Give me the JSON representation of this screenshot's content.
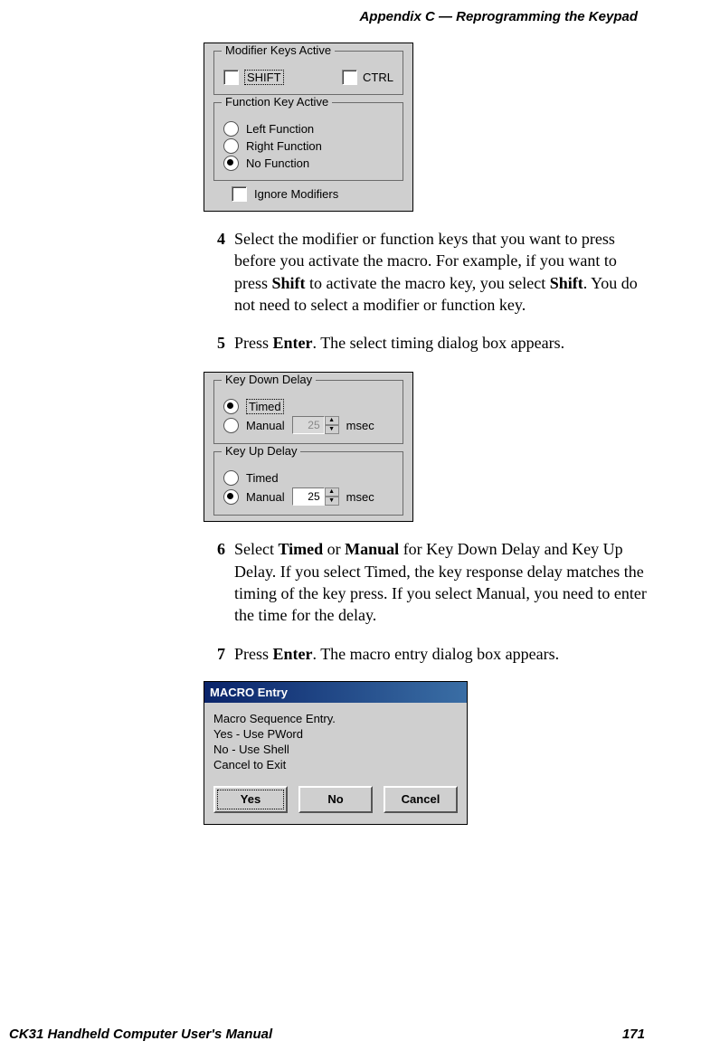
{
  "header": "Appendix C — Reprogramming the Keypad",
  "footer_left": "CK31 Handheld Computer User's Manual",
  "footer_right": "171",
  "panel1": {
    "group1_title": "Modifier Keys Active",
    "shift": "SHIFT",
    "ctrl": "CTRL",
    "group2_title": "Function Key Active",
    "opt_left": "Left Function",
    "opt_right": "Right Function",
    "opt_none": "No Function",
    "ignore": "Ignore Modifiers"
  },
  "step4": {
    "num": "4",
    "text_a": "Select the modifier or function keys that you want to press before you activate the macro. For example, if you want to press ",
    "b1": "Shift",
    "text_b": " to activate the macro key, you select ",
    "b2": "Shift",
    "text_c": ". You do not need to select a modifier or function key."
  },
  "step5": {
    "num": "5",
    "text_a": "Press ",
    "b1": "Enter",
    "text_b": ". The select timing dialog box appears."
  },
  "panel2": {
    "g1": "Key Down Delay",
    "g1_timed": "Timed",
    "g1_manual": "Manual",
    "g1_value": "25",
    "g1_unit": "msec",
    "g2": "Key Up Delay",
    "g2_timed": "Timed",
    "g2_manual": "Manual",
    "g2_value": "25",
    "g2_unit": "msec"
  },
  "step6": {
    "num": "6",
    "text_a": "Select ",
    "b1": "Timed",
    "text_b": " or ",
    "b2": "Manual",
    "text_c": " for Key Down Delay and Key Up Delay. If you select Timed, the key response delay matches the timing of the key press. If you select Manual, you need to enter the time for the delay."
  },
  "step7": {
    "num": "7",
    "text_a": "Press ",
    "b1": "Enter",
    "text_b": ". The macro entry dialog box appears."
  },
  "panel3": {
    "title": "MACRO Entry",
    "line1": "Macro Sequence Entry.",
    "line2": "Yes - Use PWord",
    "line3": "No - Use Shell",
    "line4": "Cancel to Exit",
    "yes": "Yes",
    "no": "No",
    "cancel": "Cancel"
  }
}
